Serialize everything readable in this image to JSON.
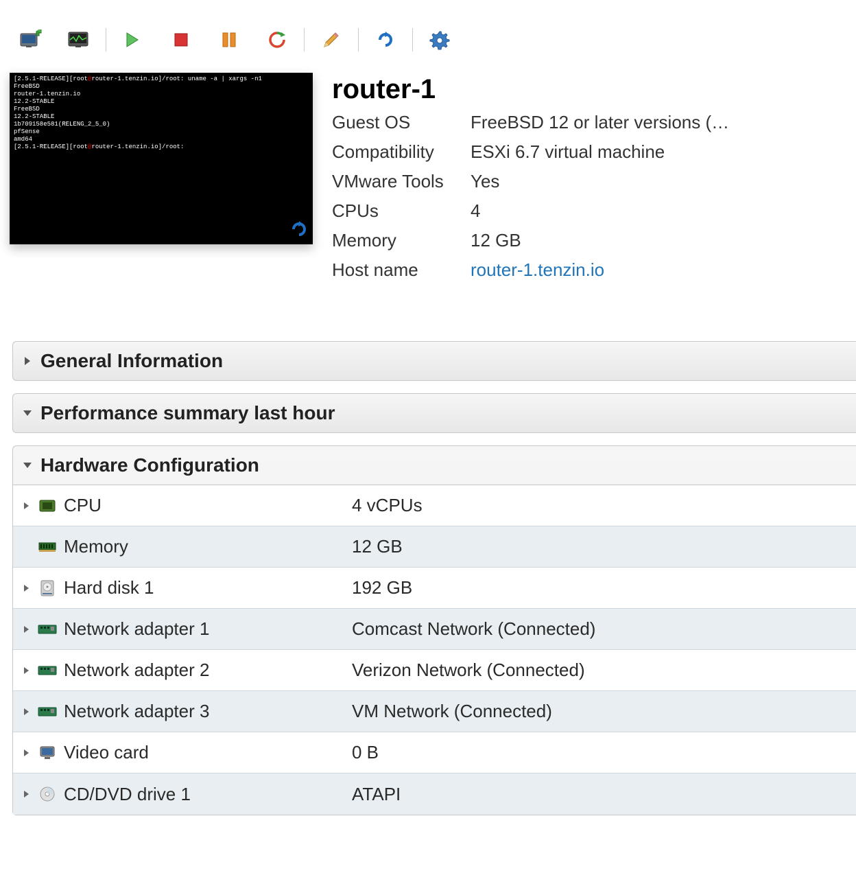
{
  "console": {
    "lines": [
      {
        "t": "prompt",
        "text": "[2.5.1-RELEASE][root@router-1.tenzin.io]/root: uname -a | xargs -n1"
      },
      {
        "t": "out",
        "text": "FreeBSD"
      },
      {
        "t": "out",
        "text": "router-1.tenzin.io"
      },
      {
        "t": "out",
        "text": "12.2-STABLE"
      },
      {
        "t": "out",
        "text": "FreeBSD"
      },
      {
        "t": "out",
        "text": "12.2-STABLE"
      },
      {
        "t": "out",
        "text": "1b709158e581(RELENG_2_5_0)"
      },
      {
        "t": "out",
        "text": "pfSense"
      },
      {
        "t": "out",
        "text": "amd64"
      },
      {
        "t": "prompt",
        "text": "[2.5.1-RELEASE][root@router-1.tenzin.io]/root: "
      }
    ]
  },
  "vm": {
    "name": "router-1",
    "guest_os_label": "Guest OS",
    "guest_os": "FreeBSD 12 or later versions (…",
    "compat_label": "Compatibility",
    "compat": "ESXi 6.7 virtual machine",
    "tools_label": "VMware Tools",
    "tools": "Yes",
    "cpus_label": "CPUs",
    "cpus": "4",
    "memory_label": "Memory",
    "memory": "12 GB",
    "hostname_label": "Host name",
    "hostname": "router-1.tenzin.io"
  },
  "panels": {
    "general": "General Information",
    "perf": "Performance summary last hour",
    "hw": "Hardware Configuration"
  },
  "hardware": {
    "cpu_label": "CPU",
    "cpu_value": "4 vCPUs",
    "mem_label": "Memory",
    "mem_value": "12 GB",
    "hd1_label": "Hard disk 1",
    "hd1_value": "192 GB",
    "nic1_label": "Network adapter 1",
    "nic1_value": "Comcast Network (Connected)",
    "nic2_label": "Network adapter 2",
    "nic2_value": "Verizon Network (Connected)",
    "nic3_label": "Network adapter 3",
    "nic3_value": "VM Network (Connected)",
    "video_label": "Video card",
    "video_value": "0 B",
    "cd_label": "CD/DVD drive 1",
    "cd_value": "ATAPI"
  }
}
